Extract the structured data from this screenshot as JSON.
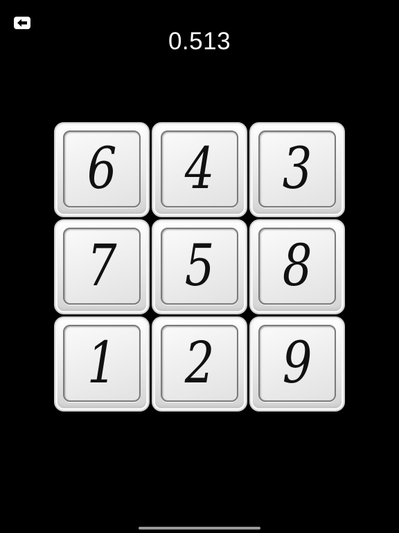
{
  "header": {
    "back_icon": "back-arrow-icon",
    "timer": "0.513"
  },
  "board": {
    "tiles": [
      {
        "label": "6"
      },
      {
        "label": "4"
      },
      {
        "label": "3"
      },
      {
        "label": "7"
      },
      {
        "label": "5"
      },
      {
        "label": "8"
      },
      {
        "label": "1"
      },
      {
        "label": "2"
      },
      {
        "label": "9"
      }
    ]
  },
  "colors": {
    "background": "#000000",
    "text": "#ffffff",
    "tile": "#e9e9e9",
    "digit": "#111111"
  }
}
